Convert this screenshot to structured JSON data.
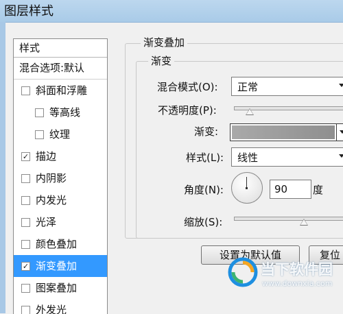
{
  "window": {
    "title": "图层样式"
  },
  "styles_panel": {
    "header": "样式",
    "blend_options": "混合选项:默认",
    "items": [
      {
        "label": "斜面和浮雕",
        "checked": false,
        "sub": false,
        "selected": false
      },
      {
        "label": "等高线",
        "checked": false,
        "sub": true,
        "selected": false
      },
      {
        "label": "纹理",
        "checked": false,
        "sub": true,
        "selected": false
      },
      {
        "label": "描边",
        "checked": true,
        "sub": false,
        "selected": false
      },
      {
        "label": "内阴影",
        "checked": false,
        "sub": false,
        "selected": false
      },
      {
        "label": "内发光",
        "checked": false,
        "sub": false,
        "selected": false
      },
      {
        "label": "光泽",
        "checked": false,
        "sub": false,
        "selected": false
      },
      {
        "label": "颜色叠加",
        "checked": false,
        "sub": false,
        "selected": false
      },
      {
        "label": "渐变叠加",
        "checked": true,
        "sub": false,
        "selected": true
      },
      {
        "label": "图案叠加",
        "checked": false,
        "sub": false,
        "selected": false
      },
      {
        "label": "外发光",
        "checked": false,
        "sub": false,
        "selected": false
      }
    ]
  },
  "gradient_overlay": {
    "title": "渐变叠加",
    "group_title": "渐变",
    "blend_mode_label": "混合模式(O):",
    "blend_mode_value": "正常",
    "opacity_label": "不透明度(P):",
    "opacity_value": 0.14,
    "gradient_label": "渐变:",
    "gradient_colors": [
      "#a9a9a9",
      "#8f8f8f"
    ],
    "style_label": "样式(L):",
    "style_value": "线性",
    "angle_label": "角度(N):",
    "angle_value": "90",
    "angle_unit": "度",
    "scale_label": "缩放(S):",
    "scale_value": 0.62,
    "default_button": "设置为默认值",
    "reset_button": "复位"
  },
  "watermark": {
    "brand": "当下软件园",
    "url": "www.downxia.com",
    "logo_colors": [
      "#1e8fe0",
      "#f5a623",
      "#3cb371"
    ]
  }
}
